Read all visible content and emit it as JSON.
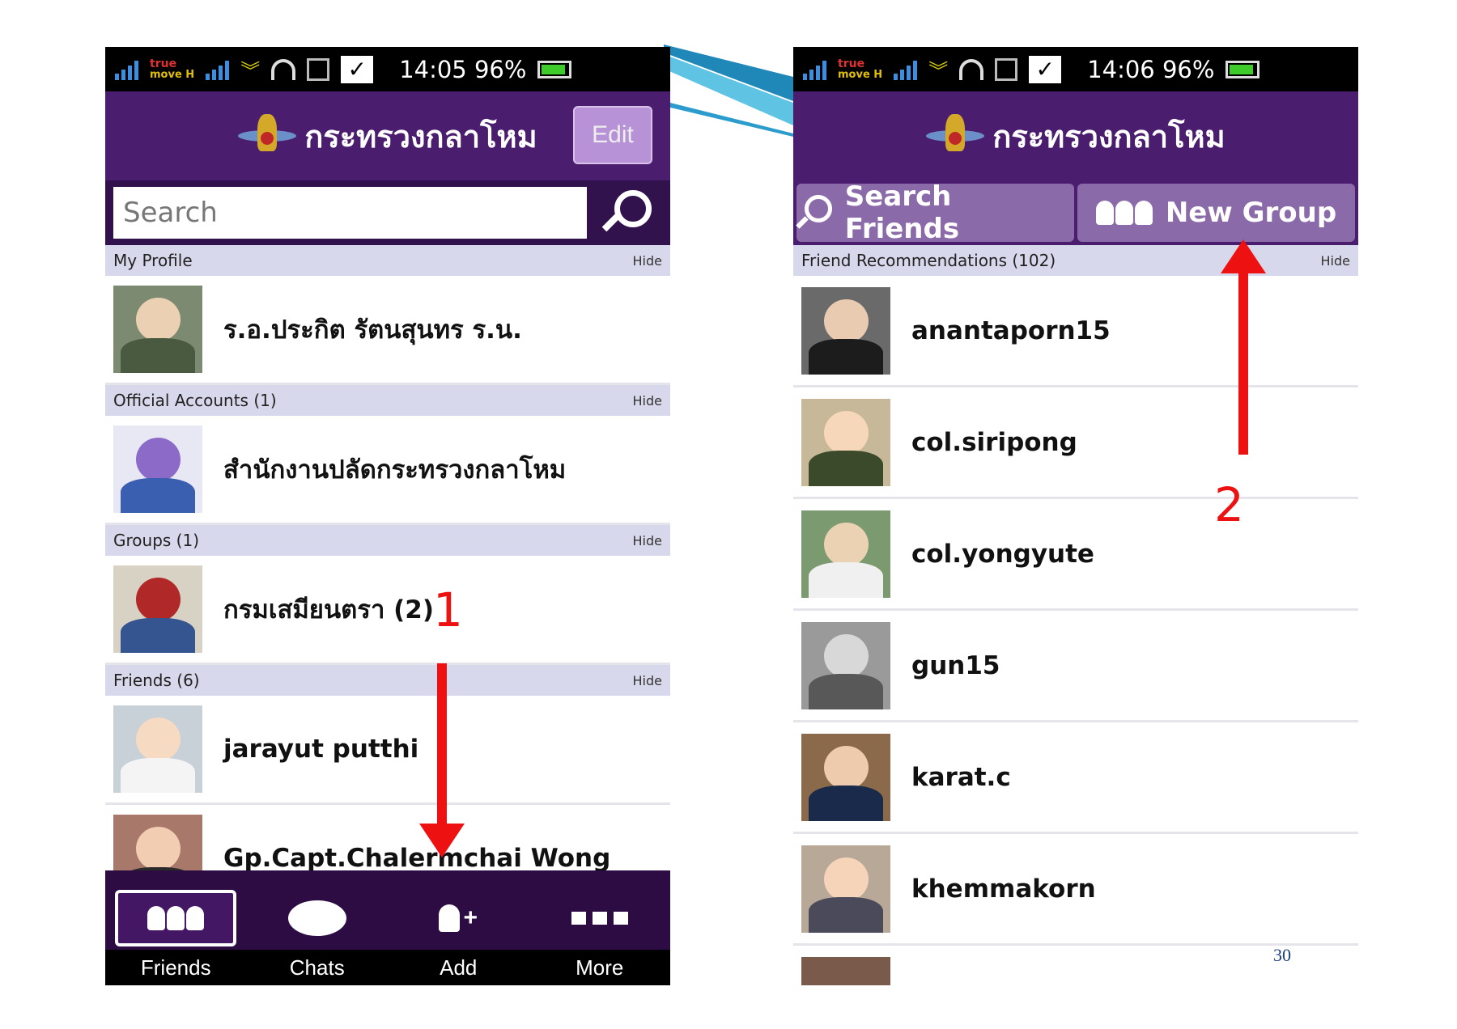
{
  "left_phone": {
    "status": {
      "carrier": "true",
      "carrier_sub": "move H",
      "time": "14:05",
      "battery": "96%"
    },
    "header": {
      "title": "กระทรวงกลาโหม",
      "edit_label": "Edit"
    },
    "search": {
      "placeholder": "Search"
    },
    "sections": {
      "my_profile": {
        "label": "My Profile",
        "hide": "Hide",
        "name": "ร.อ.ประกิต รัตนสุนทร ร.น."
      },
      "official": {
        "label": "Official Accounts (1)",
        "hide": "Hide",
        "name": "สำนักงานปลัดกระทรวงกลาโหม"
      },
      "groups": {
        "label": "Groups (1)",
        "hide": "Hide",
        "name": "กรมเสมียนตรา (2)"
      },
      "friends": {
        "label": "Friends (6)",
        "hide": "Hide",
        "items": [
          "jarayut  putthi",
          "Gp.Capt.Chalermchai  Wong"
        ]
      }
    },
    "nav": {
      "items": [
        "Friends",
        "Chats",
        "Add",
        "More"
      ],
      "active": "Friends"
    }
  },
  "right_phone": {
    "status": {
      "carrier": "true",
      "carrier_sub": "move H",
      "time": "14:06",
      "battery": "96%"
    },
    "header": {
      "title": "กระทรวงกลาโหม"
    },
    "tabs": {
      "search_friends": "Search Friends",
      "new_group": "New Group"
    },
    "recommendations": {
      "label": "Friend Recommendations (102)",
      "hide": "Hide",
      "items": [
        "anantaporn15",
        "col.siripong",
        "col.yongyute",
        "gun15",
        "karat.c",
        "khemmakorn"
      ]
    }
  },
  "annotations": {
    "step1": "1",
    "step2": "2",
    "arrow_color": "#ee1111"
  },
  "page_number": "30",
  "colors": {
    "header_purple": "#4b1d6e",
    "search_bar": "#32124d",
    "section_band": "#d8d8ec",
    "nav_bg": "#2d0c44"
  },
  "icons": [
    "signal-icon",
    "wifi-icon",
    "gallery-icon",
    "check-icon",
    "battery-icon",
    "search-icon",
    "friends-icon",
    "chat-bubble-icon",
    "add-friend-icon",
    "more-icon",
    "group-icon"
  ]
}
